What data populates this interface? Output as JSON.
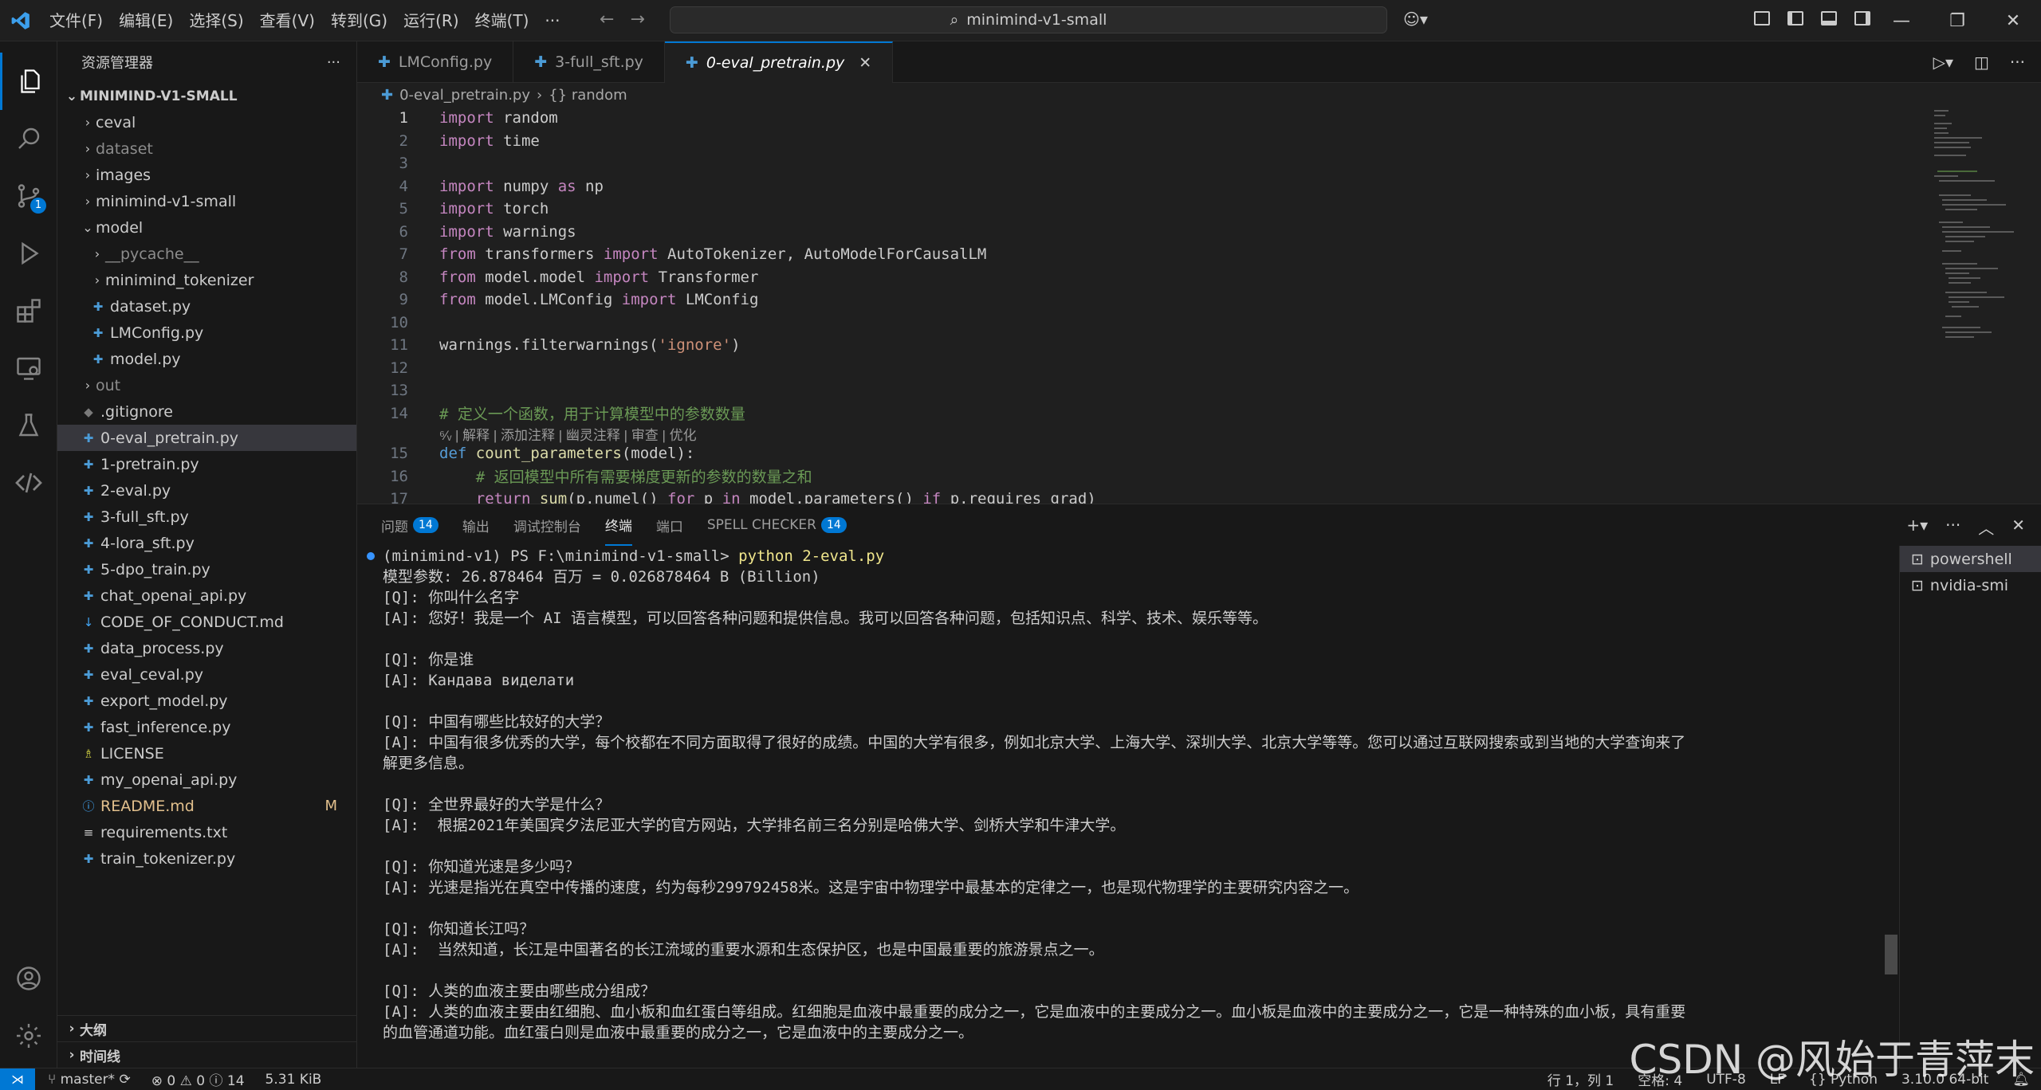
{
  "titlebar": {
    "menu": [
      "文件(F)",
      "编辑(E)",
      "选择(S)",
      "查看(V)",
      "转到(G)",
      "运行(R)",
      "终端(T)",
      "···"
    ],
    "search": "minimind-v1-small"
  },
  "activity": {
    "scm_badge": "1"
  },
  "sidebar": {
    "title": "资源管理器",
    "more": "···",
    "root": "MINIMIND-V1-SMALL",
    "items": [
      {
        "label": "ceval",
        "type": "folder",
        "depth": 1
      },
      {
        "label": "dataset",
        "type": "folder",
        "depth": 1,
        "dim": true
      },
      {
        "label": "images",
        "type": "folder",
        "depth": 1
      },
      {
        "label": "minimind-v1-small",
        "type": "folder",
        "depth": 1
      },
      {
        "label": "model",
        "type": "folder-open",
        "depth": 1
      },
      {
        "label": "__pycache__",
        "type": "folder",
        "depth": 2,
        "dim": true
      },
      {
        "label": "minimind_tokenizer",
        "type": "folder",
        "depth": 2
      },
      {
        "label": "dataset.py",
        "type": "py",
        "depth": 2
      },
      {
        "label": "LMConfig.py",
        "type": "py",
        "depth": 2
      },
      {
        "label": "model.py",
        "type": "py",
        "depth": 2
      },
      {
        "label": "out",
        "type": "folder",
        "depth": 1,
        "dim": true
      },
      {
        "label": ".gitignore",
        "type": "git",
        "depth": 1
      },
      {
        "label": "0-eval_pretrain.py",
        "type": "py",
        "depth": 1,
        "selected": true
      },
      {
        "label": "1-pretrain.py",
        "type": "py",
        "depth": 1
      },
      {
        "label": "2-eval.py",
        "type": "py",
        "depth": 1
      },
      {
        "label": "3-full_sft.py",
        "type": "py",
        "depth": 1
      },
      {
        "label": "4-lora_sft.py",
        "type": "py",
        "depth": 1
      },
      {
        "label": "5-dpo_train.py",
        "type": "py",
        "depth": 1
      },
      {
        "label": "chat_openai_api.py",
        "type": "py",
        "depth": 1
      },
      {
        "label": "CODE_OF_CONDUCT.md",
        "type": "md",
        "depth": 1
      },
      {
        "label": "data_process.py",
        "type": "py",
        "depth": 1
      },
      {
        "label": "eval_ceval.py",
        "type": "py",
        "depth": 1
      },
      {
        "label": "export_model.py",
        "type": "py",
        "depth": 1
      },
      {
        "label": "fast_inference.py",
        "type": "py",
        "depth": 1
      },
      {
        "label": "LICENSE",
        "type": "lic",
        "depth": 1
      },
      {
        "label": "my_openai_api.py",
        "type": "py",
        "depth": 1
      },
      {
        "label": "README.md",
        "type": "info",
        "depth": 1,
        "modified": "M"
      },
      {
        "label": "requirements.txt",
        "type": "txt",
        "depth": 1
      },
      {
        "label": "train_tokenizer.py",
        "type": "py",
        "depth": 1
      }
    ],
    "outline": "大纲",
    "timeline": "时间线"
  },
  "tabs": [
    {
      "label": "LMConfig.py",
      "active": false
    },
    {
      "label": "3-full_sft.py",
      "active": false
    },
    {
      "label": "0-eval_pretrain.py",
      "active": true
    }
  ],
  "breadcrumb": {
    "file": "0-eval_pretrain.py",
    "symbol": "{} random"
  },
  "code": {
    "lines": [
      {
        "n": "1",
        "tokens": [
          [
            "kw",
            "import"
          ],
          [
            "plain",
            " random"
          ]
        ]
      },
      {
        "n": "2",
        "tokens": [
          [
            "kw",
            "import"
          ],
          [
            "plain",
            " time"
          ]
        ]
      },
      {
        "n": "3",
        "tokens": []
      },
      {
        "n": "4",
        "tokens": [
          [
            "kw",
            "import"
          ],
          [
            "plain",
            " numpy "
          ],
          [
            "kw",
            "as"
          ],
          [
            "plain",
            " np"
          ]
        ]
      },
      {
        "n": "5",
        "tokens": [
          [
            "kw",
            "import"
          ],
          [
            "plain",
            " torch"
          ]
        ]
      },
      {
        "n": "6",
        "tokens": [
          [
            "kw",
            "import"
          ],
          [
            "plain",
            " warnings"
          ]
        ]
      },
      {
        "n": "7",
        "tokens": [
          [
            "kw",
            "from"
          ],
          [
            "plain",
            " transformers "
          ],
          [
            "kw",
            "import"
          ],
          [
            "plain",
            " AutoTokenizer, AutoModelForCausalLM"
          ]
        ]
      },
      {
        "n": "8",
        "tokens": [
          [
            "kw",
            "from"
          ],
          [
            "plain",
            " model.model "
          ],
          [
            "kw",
            "import"
          ],
          [
            "plain",
            " Transformer"
          ]
        ]
      },
      {
        "n": "9",
        "tokens": [
          [
            "kw",
            "from"
          ],
          [
            "plain",
            " model.LMConfig "
          ],
          [
            "kw",
            "import"
          ],
          [
            "plain",
            " LMConfig"
          ]
        ]
      },
      {
        "n": "10",
        "tokens": []
      },
      {
        "n": "11",
        "tokens": [
          [
            "plain",
            "warnings.filterwarnings("
          ],
          [
            "str",
            "'ignore'"
          ],
          [
            "plain",
            ")"
          ]
        ]
      },
      {
        "n": "12",
        "tokens": []
      },
      {
        "n": "13",
        "tokens": []
      },
      {
        "n": "14",
        "tokens": [
          [
            "cmt",
            "# 定义一个函数，用于计算模型中的参数数量"
          ]
        ]
      },
      {
        "n": "",
        "lens": "⁶⁄ᵥ | 解释 | 添加注释 | 幽灵注释 | 审查 | 优化"
      },
      {
        "n": "15",
        "tokens": [
          [
            "kw2",
            "def"
          ],
          [
            "plain",
            " "
          ],
          [
            "fn",
            "count_parameters"
          ],
          [
            "plain",
            "(model):"
          ]
        ]
      },
      {
        "n": "16",
        "tokens": [
          [
            "plain",
            "    "
          ],
          [
            "cmt",
            "# 返回模型中所有需要梯度更新的参数的数量之和"
          ]
        ]
      },
      {
        "n": "17",
        "tokens": [
          [
            "plain",
            "    "
          ],
          [
            "kw",
            "return"
          ],
          [
            "plain",
            " "
          ],
          [
            "fn",
            "sum"
          ],
          [
            "plain",
            "(p.numel() "
          ],
          [
            "kw",
            "for"
          ],
          [
            "plain",
            " p "
          ],
          [
            "kw",
            "in"
          ],
          [
            "plain",
            " model.parameters() "
          ],
          [
            "kw",
            "if"
          ],
          [
            "plain",
            " p.requires_grad)"
          ]
        ]
      }
    ]
  },
  "panel": {
    "tabs": [
      {
        "label": "问题",
        "badge": "14"
      },
      {
        "label": "输出"
      },
      {
        "label": "调试控制台"
      },
      {
        "label": "终端",
        "active": true
      },
      {
        "label": "端口"
      },
      {
        "label": "SPELL CHECKER",
        "badge": "14"
      }
    ],
    "terminals": [
      "powershell",
      "nvidia-smi"
    ]
  },
  "terminal": {
    "prompt": "(minimind-v1) PS F:\\minimind-v1-small> ",
    "command": "python 2-eval.py",
    "lines": [
      "模型参数: 26.878464 百万 = 0.026878464 B (Billion)",
      "[Q]: 你叫什么名字",
      "[A]: 您好！我是一个 AI 语言模型，可以回答各种问题和提供信息。我可以回答各种问题，包括知识点、科学、技术、娱乐等等。",
      "",
      "[Q]: 你是谁",
      "[A]: Кандава виделати",
      "",
      "[Q]: 中国有哪些比较好的大学？",
      "[A]: 中国有很多优秀的大学，每个校都在不同方面取得了很好的成绩。中国的大学有很多，例如北京大学、上海大学、深圳大学、北京大学等等。您可以通过互联网搜索或到当地的大学查询来了",
      "解更多信息。",
      "",
      "[Q]: 全世界最好的大学是什么？",
      "[A]:  根据2021年美国宾夕法尼亚大学的官方网站，大学排名前三名分别是哈佛大学、剑桥大学和牛津大学。",
      "",
      "[Q]: 你知道光速是多少吗？",
      "[A]: 光速是指光在真空中传播的速度，约为每秒299792458米。这是宇宙中物理学中最基本的定律之一，也是现代物理学的主要研究内容之一。",
      "",
      "[Q]: 你知道长江吗？",
      "[A]:  当然知道，长江是中国著名的长江流域的重要水源和生态保护区，也是中国最重要的旅游景点之一。",
      "",
      "[Q]: 人类的血液主要由哪些成分组成？",
      "[A]: 人类的血液主要由红细胞、血小板和血红蛋白等组成。红细胞是血液中最重要的成分之一，它是血液中的主要成分之一。血小板是血液中的主要成分之一，它是一种特殊的血小板，具有重要",
      "的血管通道功能。血红蛋白则是血液中最重要的成分之一，它是血液中的主要成分之一。"
    ]
  },
  "status": {
    "branch": "master*",
    "errors": "0",
    "warnings": "0",
    "info": "14",
    "size": "5.31 KiB",
    "position": "行 1，列 1",
    "spaces": "空格: 4",
    "encoding": "UTF-8",
    "eol": "LF",
    "lang": "{} Python",
    "interpreter": "3.10.0 64-bit"
  },
  "watermark": "CSDN @风始于青萍末",
  "colors": {
    "accent": "#0078d4",
    "bg": "#1f1f1f",
    "sidebar_bg": "#181818"
  }
}
